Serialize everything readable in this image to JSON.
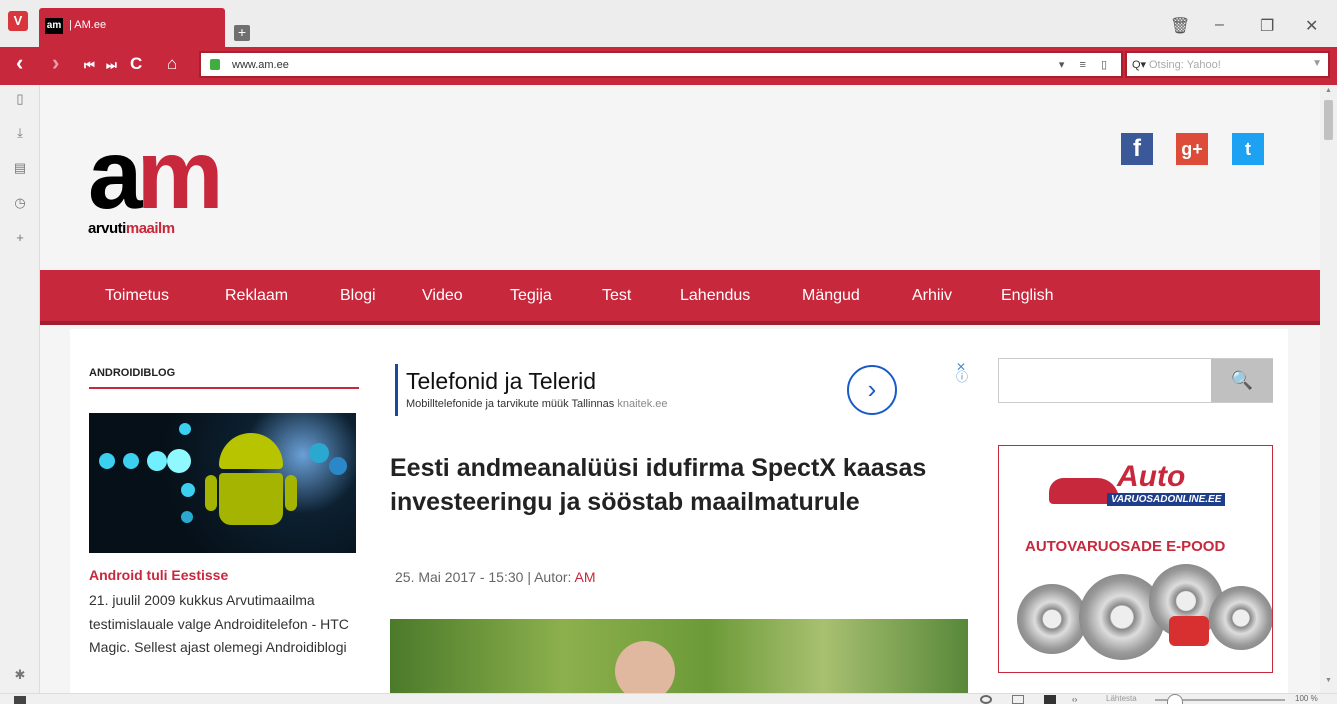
{
  "browser": {
    "tab_title": "| AM.ee",
    "tab_favicon": "am",
    "logo_letter": "V",
    "new_tab": "+",
    "url": "www.am.ee",
    "url_tools": "▾ ≡ ▯",
    "search_placeholder": "Otsing: Yahoo!",
    "search_engine_icon": "Q▾",
    "zoom_label": "Lähtesta",
    "zoom_value": "100 %",
    "zoom_level": 0.15,
    "controls": {
      "trash": "🗑",
      "minimize": "–",
      "restore": "❐",
      "close": "✕"
    },
    "nav_icons": {
      "back": "‹",
      "forward": "›",
      "first": "⏮",
      "last": "⏭",
      "reload": "C",
      "home": "⌂"
    },
    "sidebar_icons": {
      "bookmarks": "▯",
      "downloads": "⤓",
      "notes": "▤",
      "history": "◷",
      "add": "+",
      "settings": "✱"
    }
  },
  "site": {
    "logo_am_a": "a",
    "logo_am_m": "m",
    "logo_text_a": "arvuti",
    "logo_text_b": "maailm",
    "social": {
      "facebook": "f",
      "googleplus": "g+",
      "twitter": "t"
    },
    "menu": [
      "Toimetus",
      "Reklaam",
      "Blogi",
      "Video",
      "Tegija",
      "Test",
      "Lahendus",
      "Mängud",
      "Arhiiv",
      "English"
    ],
    "blog": {
      "heading": "ANDROIDIBLOG",
      "article_title": "Android tuli Eestisse",
      "article_text": "21. juulil 2009 kukkus Arvutimaailma testimislauale valge Androiditelefon - HTC Magic. Sellest ajast olemegi Androidiblogi"
    },
    "ad": {
      "title": "Telefonid ja Telerid",
      "subtitle": "Mobilltelefonide ja tarvikute müük Tallinnas",
      "link": "knaitek.ee",
      "arrow": "›",
      "close": "✕"
    },
    "article": {
      "title": "Eesti andmeanalüüsi idufirma SpectX kaasas investeeringu ja sööstab maailmaturule",
      "date": "25. Mai 2017 - 15:30",
      "author_label": "| Autor:",
      "author": "AM"
    },
    "search_button_icon": "🔍",
    "banner": {
      "brand": "Auto",
      "brand_sub": "VARUOSADONLINE.EE",
      "caption": "AUTOVARUOSADE E-POOD"
    }
  },
  "colors": {
    "accent": "#c8283c",
    "accent_dark": "#a01e30",
    "link_blue": "#1a5bc8"
  }
}
